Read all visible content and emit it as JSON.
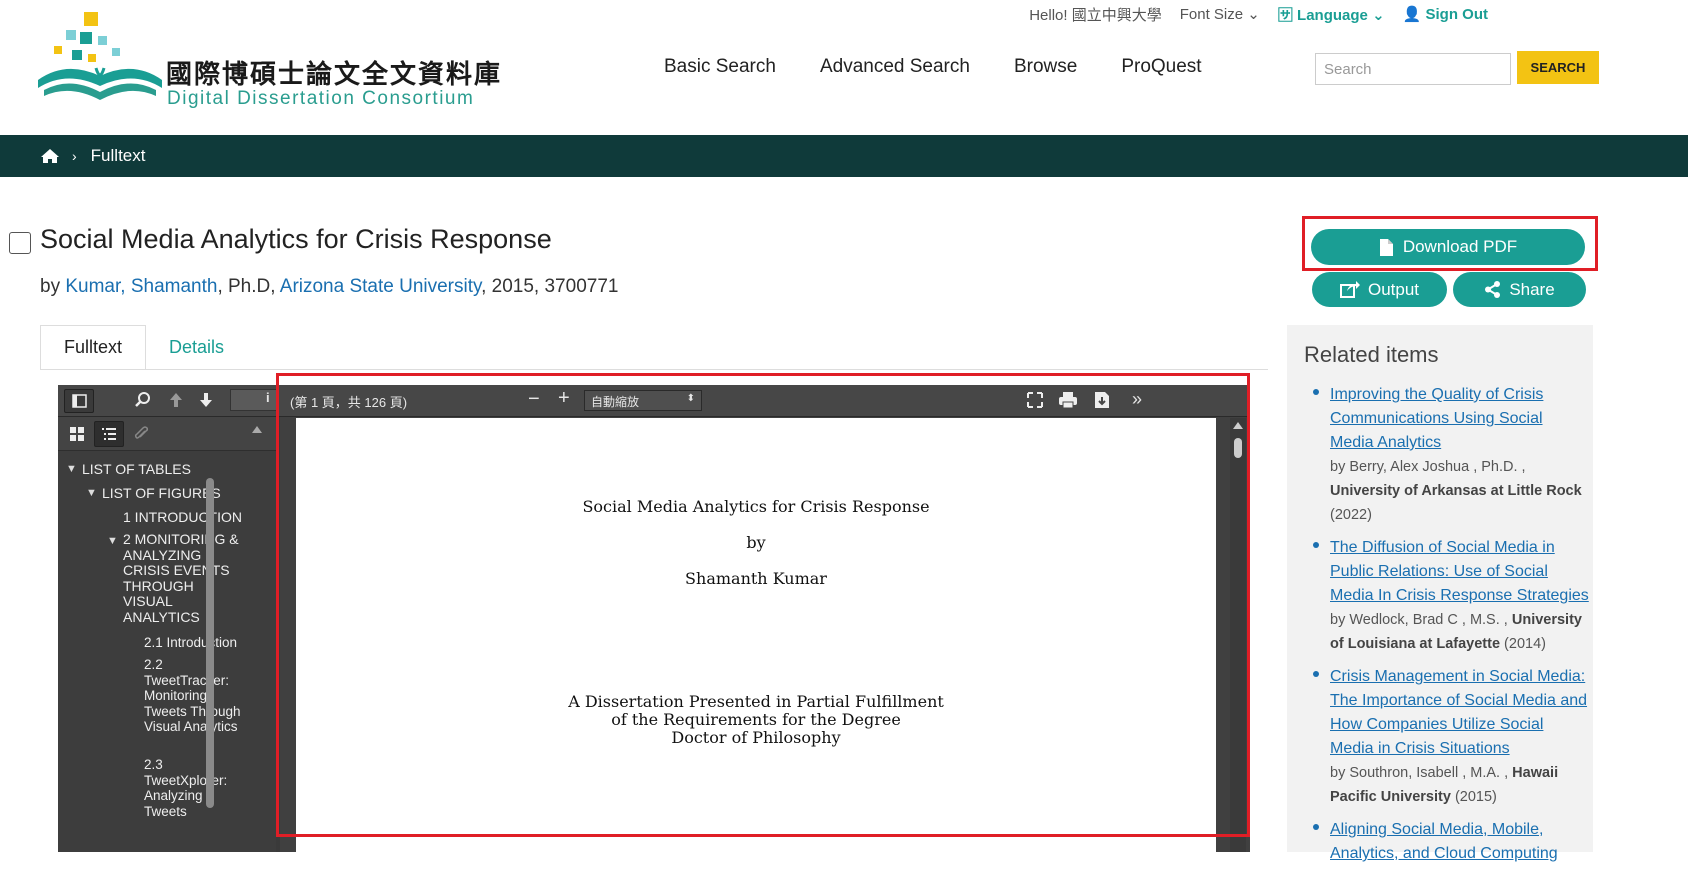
{
  "header": {
    "logo_zh": "國際博碩士論文全文資料庫",
    "logo_en": "Digital Dissertation Consortium",
    "greeting": "Hello! 國立中興大學",
    "font_size": "Font Size",
    "language": "Language",
    "sign_out": "Sign Out",
    "nav": [
      "Basic Search",
      "Advanced Search",
      "Browse",
      "ProQuest"
    ],
    "search_placeholder": "Search",
    "search_button": "SEARCH"
  },
  "breadcrumb": {
    "current": "Fulltext"
  },
  "document": {
    "title": "Social Media Analytics for Crisis Response",
    "by": "by",
    "author": "Kumar, Shamanth",
    "degree": ", Ph.D, ",
    "school": "Arizona State University",
    "meta": ", 2015, 3700771"
  },
  "actions": {
    "download": "Download PDF",
    "output": "Output",
    "share": "Share"
  },
  "tabs": [
    "Fulltext",
    "Details"
  ],
  "viewer": {
    "page_info": "(第 1 頁，共 126 頁)",
    "zoom": "自動縮放",
    "outline": [
      "LIST OF TABLES",
      "LIST OF FIGURES",
      "1 INTRODUCTION",
      "2 MONITORING & ANALYZING CRISIS EVENTS THROUGH VISUAL ANALYTICS",
      "2.1 Introduction",
      "2.2 TweetTracker: Monitoring Tweets Through Visual Analytics",
      "2.3 TweetXplorer: Analyzing Tweets"
    ],
    "page": {
      "title": "Social Media Analytics for Crisis Response",
      "by": "by",
      "author": "Shamanth Kumar",
      "line1": "A Dissertation Presented in Partial Fulfillment",
      "line2": "of the Requirements for the Degree",
      "line3": "Doctor of Philosophy"
    }
  },
  "related": {
    "heading": "Related items",
    "items": [
      {
        "title": "Improving the Quality of Crisis Communications Using Social Media Analytics",
        "by": "by Berry, Alex Joshua , Ph.D. ,",
        "school": "University of Arkansas at Little Rock",
        "year": "(2022)"
      },
      {
        "title": "The Diffusion of Social Media in Public Relations: Use of Social Media In Crisis Response Strategies",
        "by": "by Wedlock, Brad C , M.S. ,",
        "school": "University of Louisiana at Lafayette",
        "year": "(2014)"
      },
      {
        "title": "Crisis Management in Social Media: The Importance of Social Media and How Companies Utilize Social Media in Crisis Situations",
        "by": "by Southron, Isabell , M.A. ,",
        "school": "Hawaii Pacific University",
        "year": "(2015)"
      },
      {
        "title": "Aligning Social Media, Mobile, Analytics, and Cloud Computing",
        "by": "",
        "school": "",
        "year": ""
      }
    ]
  },
  "colors": {
    "teal": "#1a9e94",
    "dark_bar": "#0f3a3a",
    "highlight": "#e01e26",
    "search_yellow": "#f3c313"
  }
}
